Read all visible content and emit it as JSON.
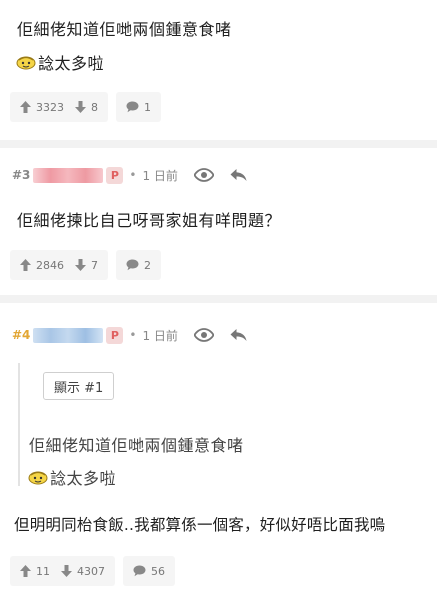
{
  "post2": {
    "line1": "佢細佬知道佢哋兩個鍾意食啫",
    "line2": "諗太多啦",
    "upvotes": "3323",
    "downvotes": "8",
    "replies": "1"
  },
  "post3": {
    "number": "#3",
    "badge": "P",
    "dot": "•",
    "time": "1 日前",
    "content": "佢細佬揀比自己呀哥家姐有咩問題？",
    "upvotes": "2846",
    "downvotes": "7",
    "replies": "2"
  },
  "post4": {
    "number": "#4",
    "badge": "P",
    "dot": "•",
    "time": "1 日前",
    "show_quote_label": "顯示 #1",
    "quote_line1": "佢細佬知道佢哋兩個鍾意食啫",
    "quote_line2": "諗太多啦",
    "content": "但明明同枱食飯..我都算係一個客，好似好唔比面我嗚",
    "upvotes": "11",
    "downvotes": "4307",
    "replies": "56"
  },
  "colors": {
    "accent_gold": "#e2a634",
    "badge_red": "#e06060",
    "divider": "#f2f2f2"
  }
}
